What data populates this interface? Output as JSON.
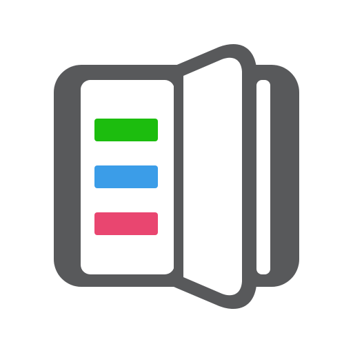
{
  "icon": {
    "name": "book-open-icon",
    "frame_color": "#58595b",
    "page_color": "#ffffff",
    "bars": [
      {
        "name": "green-bar",
        "color": "#1cbd0e"
      },
      {
        "name": "blue-bar",
        "color": "#3b9de8"
      },
      {
        "name": "pink-bar",
        "color": "#e94670"
      }
    ]
  }
}
